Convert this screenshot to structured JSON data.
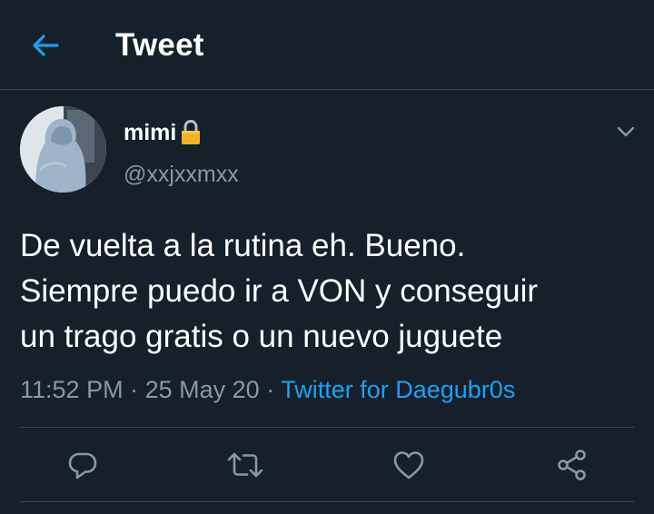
{
  "header": {
    "title": "Tweet",
    "back_icon": "arrow-left-icon"
  },
  "author": {
    "display_name": "mimi",
    "handle": "@xxjxxmxx",
    "protected_icon": "lock-icon"
  },
  "tweet": {
    "lines": [
      "De vuelta a la rutina eh. Bueno.",
      "Siempre puedo ir a VON y conseguir",
      "un trago gratis o un nuevo juguete"
    ],
    "time": "11:52 PM",
    "separator": "·",
    "date": "25 May 20",
    "source": "Twitter for Daegubr0s"
  },
  "actions": {
    "reply_icon": "reply-icon",
    "retweet_icon": "retweet-icon",
    "like_icon": "heart-icon",
    "share_icon": "share-icon"
  },
  "colors": {
    "background": "#15202b",
    "accent": "#1da1f2",
    "secondary_text": "#8899a6",
    "divider": "#38444d"
  }
}
